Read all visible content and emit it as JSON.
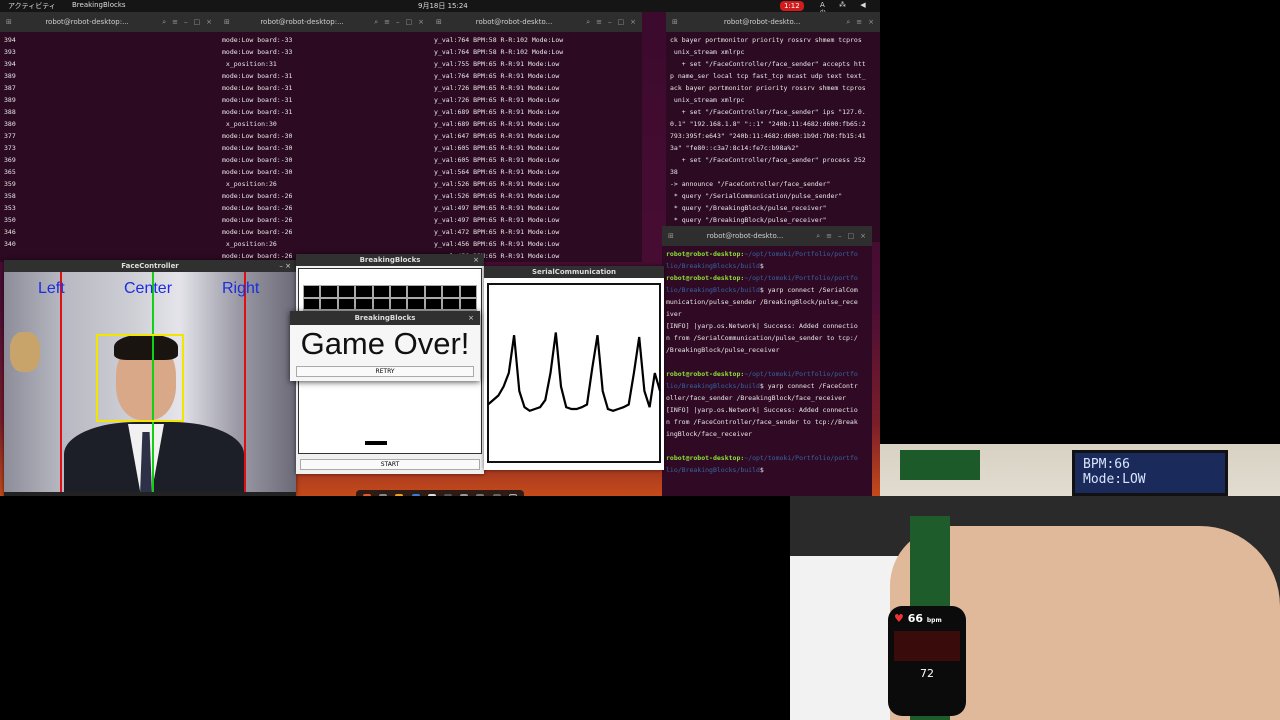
{
  "topbar": {
    "activities": "アクティビティ",
    "app": "BreakingBlocks",
    "clock": "9月18日 15:24",
    "indicator": "1:12",
    "tray": "A ⁂ ◀ ⏻"
  },
  "terminals": [
    {
      "title": "robot@robot-desktop:...",
      "lines": [
        "394",
        "393",
        "394",
        "389",
        "387",
        "389",
        "388",
        "380",
        "377",
        "373",
        "369",
        "365",
        "359",
        "358",
        "353",
        "350",
        "346",
        "340"
      ]
    },
    {
      "title": "robot@robot-desktop:...",
      "lines": [
        "mode:Low board:-33",
        "mode:Low board:-33",
        " x_position:31",
        "mode:Low board:-31",
        "mode:Low board:-31",
        "mode:Low board:-31",
        "mode:Low board:-31",
        " x_position:30",
        "mode:Low board:-30",
        "mode:Low board:-30",
        "mode:Low board:-30",
        "mode:Low board:-30",
        " x_position:26",
        "mode:Low board:-26",
        "mode:Low board:-26",
        "mode:Low board:-26",
        "mode:Low board:-26",
        " x_position:26",
        "mode:Low board:-26"
      ]
    },
    {
      "title": "robot@robot-deskto...",
      "lines": [
        "y_val:764 BPM:58 R-R:102 Mode:Low",
        "y_val:764 BPM:58 R-R:102 Mode:Low",
        "y_val:755 BPM:65 R-R:91 Mode:Low",
        "y_val:764 BPM:65 R-R:91 Mode:Low",
        "y_val:726 BPM:65 R-R:91 Mode:Low",
        "y_val:726 BPM:65 R-R:91 Mode:Low",
        "y_val:689 BPM:65 R-R:91 Mode:Low",
        "y_val:689 BPM:65 R-R:91 Mode:Low",
        "y_val:647 BPM:65 R-R:91 Mode:Low",
        "y_val:605 BPM:65 R-R:91 Mode:Low",
        "y_val:605 BPM:65 R-R:91 Mode:Low",
        "y_val:564 BPM:65 R-R:91 Mode:Low",
        "y_val:526 BPM:65 R-R:91 Mode:Low",
        "y_val:526 BPM:65 R-R:91 Mode:Low",
        "y_val:497 BPM:65 R-R:91 Mode:Low",
        "y_val:497 BPM:65 R-R:91 Mode:Low",
        "y_val:472 BPM:65 R-R:91 Mode:Low",
        "y_val:456 BPM:65 R-R:91 Mode:Low",
        "y_val:456 BPM:65 R-R:91 Mode:Low"
      ]
    },
    {
      "title": "robot@robot-deskto...",
      "lines": [
        "ck bayer portmonitor priority rossrv shmem tcpros",
        " unix_stream xmlrpc",
        "   + set \"/FaceController/face_sender\" accepts htt",
        "p name_ser local tcp fast_tcp mcast udp text text_",
        "ack bayer portmonitor priority rossrv shmem tcpros",
        " unix_stream xmlrpc",
        "   + set \"/FaceController/face_sender\" ips \"127.0.",
        "0.1\" \"192.168.1.8\" \"::1\" \"240b:11:4682:d600:fb65:2",
        "793:395f:e643\" \"240b:11:4682:d600:1b9d:7b0:fb15:41",
        "3a\" \"fe80::c3a7:8c14:fe7c:b98a%2\"",
        "   + set \"/FaceController/face_sender\" process 252",
        "38",
        "-> announce \"/FaceController/face_sender\"",
        " * query \"/SerialCommunication/pulse_sender\"",
        " * query \"/BreakingBlock/pulse_receiver\"",
        " * query \"/BreakingBlock/pulse_receiver\""
      ]
    }
  ],
  "terminal5": {
    "title": "robot@robot-deskto...",
    "lines": [
      {
        "prompt": "robot@robot-desktop:",
        "path": "~/opt/tomoki/Portfolio/portfo",
        "text": ""
      },
      {
        "prompt": "",
        "path": "lio/BreakingBlocks/build",
        "text": "$"
      },
      {
        "prompt": "robot@robot-desktop:",
        "path": "~/opt/tomoki/Portfolio/portfo",
        "text": ""
      },
      {
        "prompt": "",
        "path": "lio/BreakingBlocks/build",
        "text": "$ yarp connect /SerialCom"
      },
      {
        "prompt": "",
        "path": "",
        "text": "munication/pulse_sender /BreakingBlock/pulse_rece"
      },
      {
        "prompt": "",
        "path": "",
        "text": "iver"
      },
      {
        "prompt": "",
        "path": "",
        "text": "[INFO] |yarp.os.Network| Success: Added connectio"
      },
      {
        "prompt": "",
        "path": "",
        "text": "n from /SerialCommunication/pulse_sender to tcp:/"
      },
      {
        "prompt": "",
        "path": "",
        "text": "/BreakingBlock/pulse_receiver"
      },
      {
        "prompt": "",
        "path": "",
        "text": ""
      },
      {
        "prompt": "robot@robot-desktop:",
        "path": "~/opt/tomoki/Portfolio/portfo",
        "text": ""
      },
      {
        "prompt": "",
        "path": "lio/BreakingBlocks/build",
        "text": "$ yarp connect /FaceContr"
      },
      {
        "prompt": "",
        "path": "",
        "text": "oller/face_sender /BreakingBlock/face_receiver"
      },
      {
        "prompt": "",
        "path": "",
        "text": "[INFO] |yarp.os.Network| Success: Added connectio"
      },
      {
        "prompt": "",
        "path": "",
        "text": "n from /FaceController/face_sender to tcp://Break"
      },
      {
        "prompt": "",
        "path": "",
        "text": "ingBlock/face_receiver"
      },
      {
        "prompt": "",
        "path": "",
        "text": ""
      },
      {
        "prompt": "robot@robot-desktop:",
        "path": "~/opt/tomoki/Portfolio/portfo",
        "text": ""
      },
      {
        "prompt": "",
        "path": "lio/BreakingBlocks/build",
        "text": "$ "
      }
    ]
  },
  "face_controller": {
    "title": "FaceController",
    "left": "Left",
    "center": "Center",
    "right": "Right"
  },
  "breaking_blocks": {
    "title": "BreakingBlocks",
    "start": "START"
  },
  "dialog": {
    "title": "BreakingBlocks",
    "message": "Game Over!",
    "retry": "RETRY"
  },
  "serial": {
    "title": "SerialCommunication"
  },
  "pulse_waveform": {
    "type": "line",
    "note_values": [
      0.15,
      0.2,
      0.25,
      0.35,
      0.5,
      0.92,
      0.3,
      0.12,
      0.08,
      0.1,
      0.12,
      0.2,
      0.5,
      0.95,
      0.35,
      0.12,
      0.1,
      0.1,
      0.12,
      0.15,
      0.55,
      0.92,
      0.3,
      0.1,
      0.08,
      0.1,
      0.12,
      0.15,
      0.5,
      0.9,
      0.3,
      0.12,
      0.5,
      0.3
    ]
  },
  "hardware": {
    "lcd_line1": "BPM:66",
    "lcd_line2": "Mode:LOW",
    "watch_bpm": "66",
    "watch_unit": "bpm",
    "watch_value": "72"
  },
  "colors": {
    "face_box": "#f2e600",
    "zone_left": "#e01010",
    "zone_center": "#12d012",
    "zone_right": "#e01010",
    "label": "#1a2de0"
  }
}
